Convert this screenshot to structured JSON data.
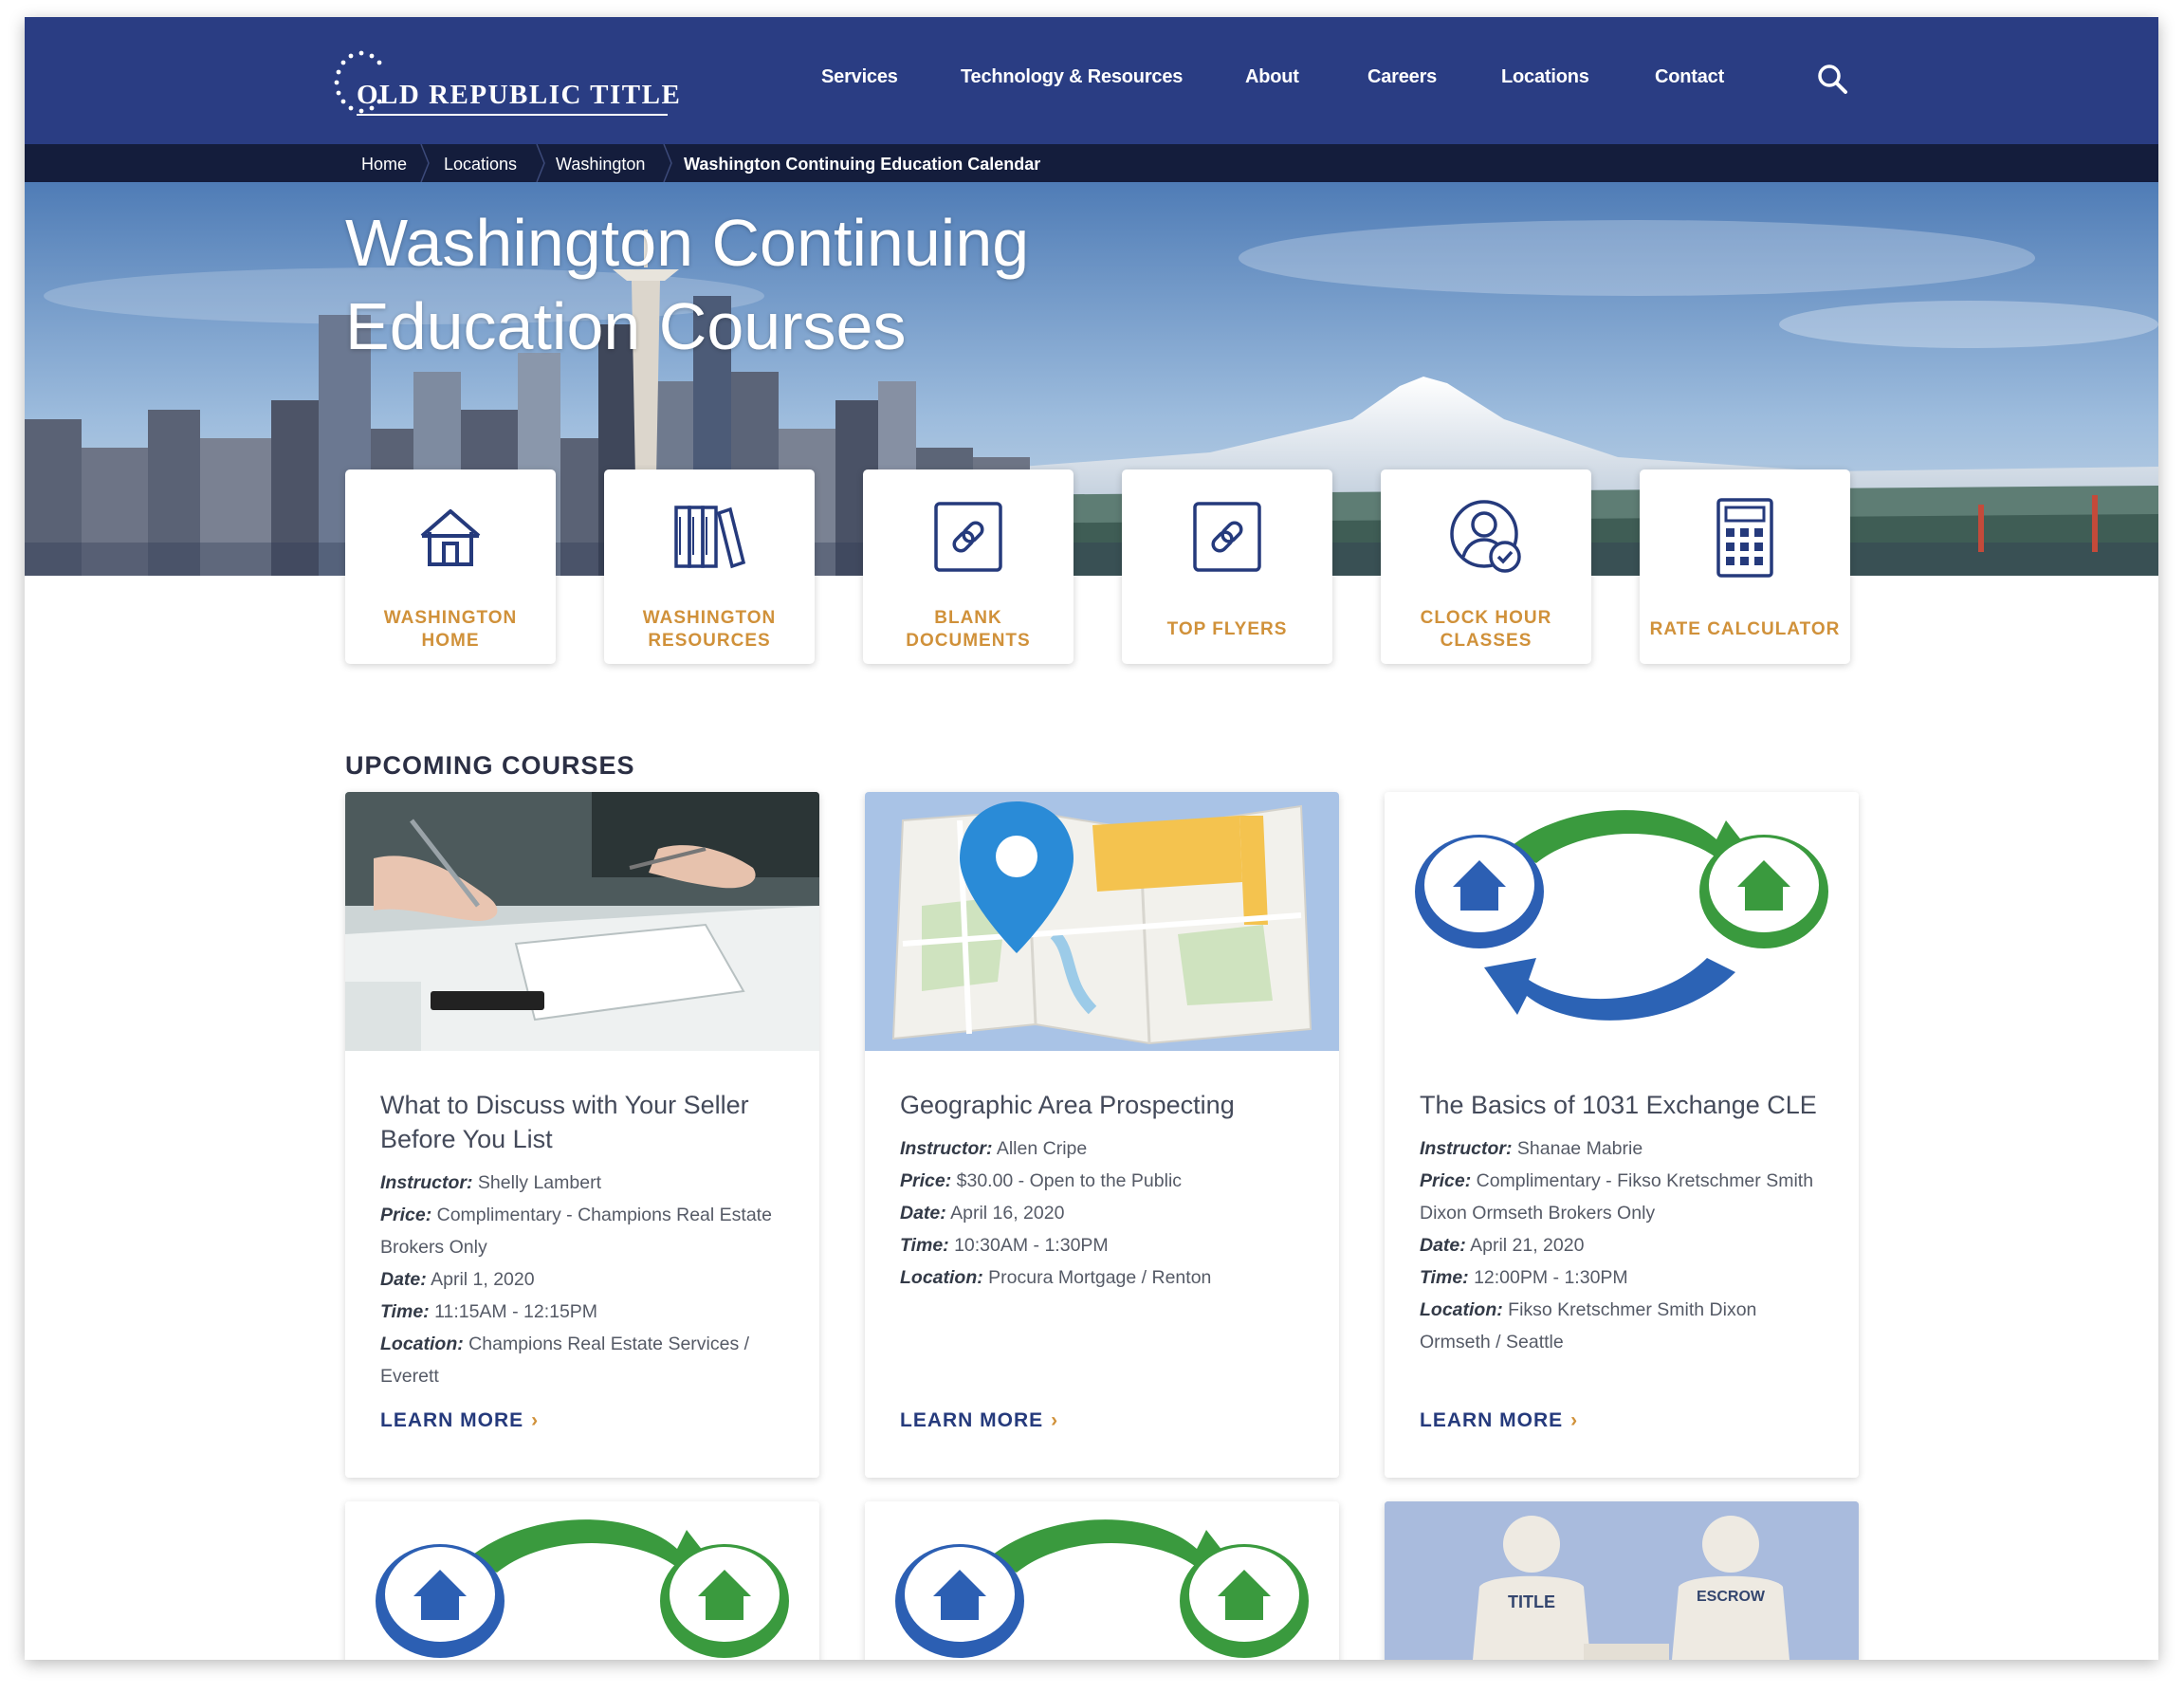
{
  "header": {
    "logo_text": "OLD REPUBLIC TITLE",
    "nav": [
      "Services",
      "Technology & Resources",
      "About",
      "Careers",
      "Locations",
      "Contact"
    ],
    "search_icon": "search-icon"
  },
  "breadcrumb": {
    "items": [
      "Home",
      "Locations",
      "Washington"
    ],
    "current": "Washington Continuing Education Calendar"
  },
  "hero": {
    "title_line1": "Washington Continuing",
    "title_line2": "Education Courses"
  },
  "quick_links": [
    {
      "label": "WASHINGTON HOME",
      "icon": "house-icon"
    },
    {
      "label": "WASHINGTON RESOURCES",
      "icon": "books-icon"
    },
    {
      "label": "BLANK DOCUMENTS",
      "icon": "link-icon"
    },
    {
      "label": "TOP FLYERS",
      "icon": "link-icon"
    },
    {
      "label": "CLOCK HOUR CLASSES",
      "icon": "user-check-icon"
    },
    {
      "label": "RATE CALCULATOR",
      "icon": "calculator-icon"
    }
  ],
  "courses_section": {
    "title": "UPCOMING COURSES",
    "field_labels": {
      "instructor": "Instructor:",
      "price": "Price:",
      "date": "Date:",
      "time": "Time:",
      "location": "Location:"
    },
    "learn_more": "LEARN MORE",
    "courses": [
      {
        "title": "What to Discuss with Your Seller Before You List",
        "instructor": "Shelly Lambert",
        "price": "Complimentary - Champions Real Estate Brokers Only",
        "date": "April 1, 2020",
        "time": "11:15AM - 12:15PM",
        "location": "Champions Real Estate Services / Everett",
        "image": "business-meeting-photo"
      },
      {
        "title": "Geographic Area Prospecting",
        "instructor": "Allen Cripe",
        "price": "$30.00 - Open to the Public",
        "date": "April 16, 2020",
        "time": "10:30AM - 1:30PM",
        "location": "Procura Mortgage / Renton",
        "image": "map-pin-illustration"
      },
      {
        "title": "The Basics of 1031 Exchange CLE",
        "instructor": "Shanae Mabrie",
        "price": "Complimentary - Fikso Kretschmer Smith Dixon Ormseth Brokers Only",
        "date": "April 21, 2020",
        "time": "12:00PM - 1:30PM",
        "location": "Fikso Kretschmer Smith Dixon Ormseth / Seattle",
        "image": "house-exchange-illustration"
      }
    ],
    "partial_cards": [
      {
        "image": "house-exchange-illustration"
      },
      {
        "image": "house-exchange-illustration"
      },
      {
        "image": "title-escrow-figures",
        "labels": [
          "TITLE",
          "ESCROW"
        ]
      }
    ]
  },
  "colors": {
    "header_blue": "#2a3d83",
    "breadcrumb_navy": "#141d3c",
    "accent_gold": "#d0913a",
    "link_navy": "#253a7c"
  }
}
